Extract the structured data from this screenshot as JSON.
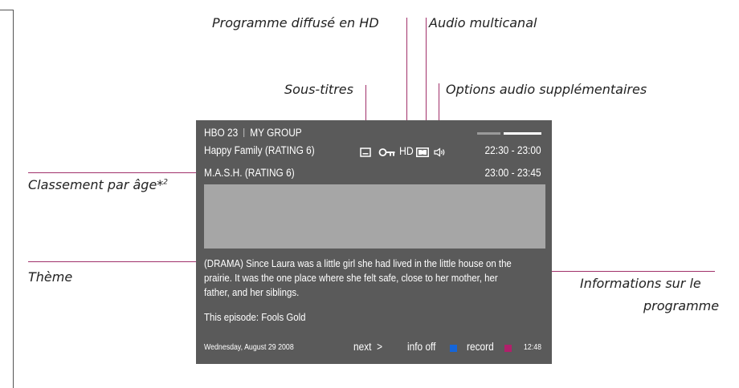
{
  "annotations": {
    "hd": "Programme diffusé en HD",
    "multichannel": "Audio multicanal",
    "subtitles": "Sous-titres",
    "audio_options": "Options audio supplémentaires",
    "age_rating": "Classement par âge*",
    "age_rating_sup": "2",
    "theme": "Thème",
    "programme_info_line1": "Informations sur le",
    "programme_info_line2": "programme"
  },
  "screen": {
    "channel": "HBO 23",
    "group": "MY GROUP",
    "now_title": "Happy Family (RATING 6)",
    "now_time": "22:30 - 23:00",
    "next_title": "M.A.S.H. (RATING 6)",
    "next_time": "23:00 - 23:45",
    "hd_label": "HD",
    "description_lines": [
      "(DRAMA) Since Laura was a little girl she had lived in the little house on the",
      "prairie. It was the one place where she felt safe, close to her mother, her",
      "father, and her siblings."
    ],
    "episode": "This episode: Fools Gold",
    "date": "Wednesday, August 29 2008",
    "next_label": "next",
    "next_arrow": ">",
    "info_off_label": "info off",
    "record_label": "record",
    "clock": "12:48"
  },
  "colors": {
    "leader_line": "#a0306a",
    "panel": "#5a5a5a",
    "image_placeholder": "#a6a6a6",
    "info_off_key": "#1565d8",
    "record_key": "#b0206a"
  },
  "icons": [
    "subtitle-icon",
    "key-icon",
    "dolby-icon",
    "speaker-icon"
  ]
}
